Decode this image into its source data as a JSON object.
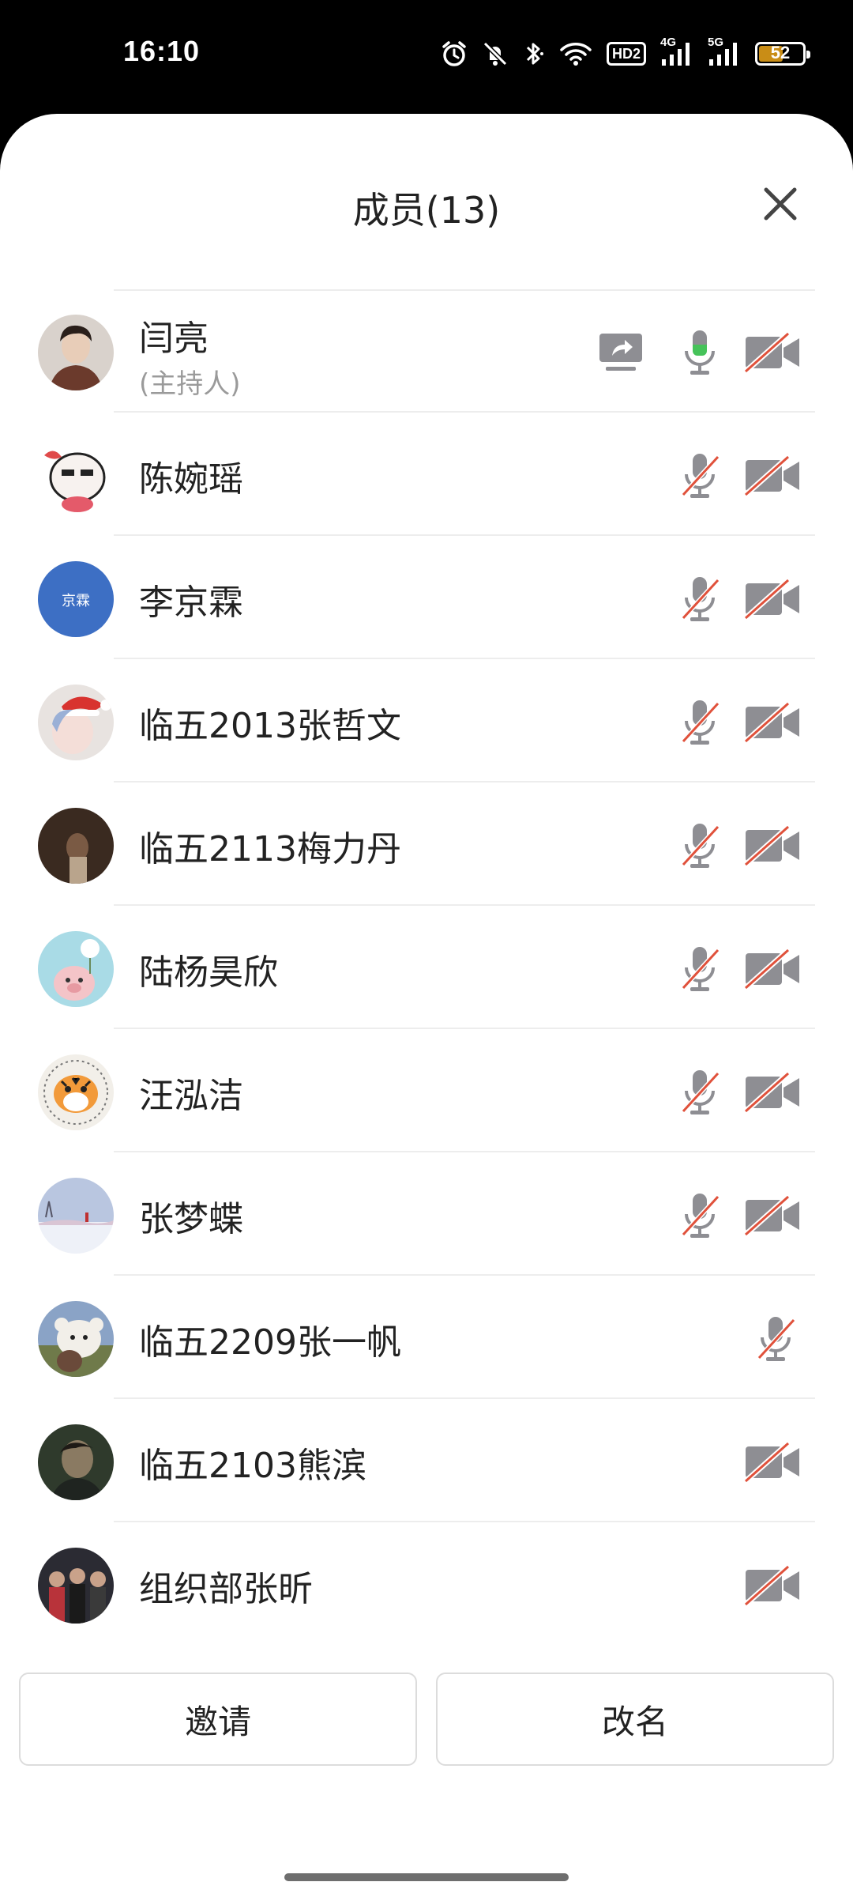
{
  "status_bar": {
    "time": "16:10",
    "battery": "52",
    "network1": "4G",
    "network2": "5G",
    "hd": "HD2",
    "icons": [
      "alarm-icon",
      "mute-icon",
      "bluetooth-icon",
      "wifi-icon",
      "hd-icon",
      "signal-4g-icon",
      "signal-5g-icon",
      "battery-icon"
    ],
    "battery_color": "#c98d16"
  },
  "sheet": {
    "title": "成员(13)",
    "close_icon": "close-icon"
  },
  "members": [
    {
      "name": "闫亮",
      "role": "(主持人)",
      "share": true,
      "mic": "on",
      "cam": "off",
      "avatar": "photo-man",
      "avatar_color": "#8a6b5c"
    },
    {
      "name": "陈婉瑶",
      "role": "",
      "share": false,
      "mic": "off",
      "cam": "off",
      "avatar": "cartoon-face",
      "avatar_color": "#f3e3dd"
    },
    {
      "name": "李京霖",
      "role": "",
      "share": false,
      "mic": "off",
      "cam": "off",
      "avatar": "text-avatar",
      "avatar_text": "京霖",
      "avatar_color": "#3d6fc4"
    },
    {
      "name": "临五2013张哲文",
      "role": "",
      "share": false,
      "mic": "off",
      "cam": "off",
      "avatar": "anime-santa",
      "avatar_color": "#e8e3e0"
    },
    {
      "name": "临五2113梅力丹",
      "role": "",
      "share": false,
      "mic": "off",
      "cam": "off",
      "avatar": "dark-photo",
      "avatar_color": "#3a2a20"
    },
    {
      "name": "陆杨昊欣",
      "role": "",
      "share": false,
      "mic": "off",
      "cam": "off",
      "avatar": "pig-cartoon",
      "avatar_color": "#a9dbe6"
    },
    {
      "name": "汪泓洁",
      "role": "",
      "share": false,
      "mic": "off",
      "cam": "off",
      "avatar": "tiger-cartoon",
      "avatar_color": "#f2efe9"
    },
    {
      "name": "张梦蝶",
      "role": "",
      "share": false,
      "mic": "off",
      "cam": "off",
      "avatar": "snow-landscape",
      "avatar_color": "#c9d3e6"
    },
    {
      "name": "临五2209张一帆",
      "role": "",
      "share": false,
      "mic": "off",
      "cam": "none",
      "avatar": "bear-cartoon",
      "avatar_color": "#6f7a4a"
    },
    {
      "name": "临五2103熊滨",
      "role": "",
      "share": false,
      "mic": "none",
      "cam": "off",
      "avatar": "dark-portrait",
      "avatar_color": "#2f3a2c"
    },
    {
      "name": "组织部张昕",
      "role": "",
      "share": false,
      "mic": "none",
      "cam": "off",
      "avatar": "group-photo",
      "avatar_color": "#2b2b33"
    }
  ],
  "buttons": {
    "invite": "邀请",
    "rename": "改名"
  },
  "colors": {
    "mic_active": "#46c35a",
    "muted_slash": "#e0513b",
    "icon_gray": "#8e8e93"
  }
}
